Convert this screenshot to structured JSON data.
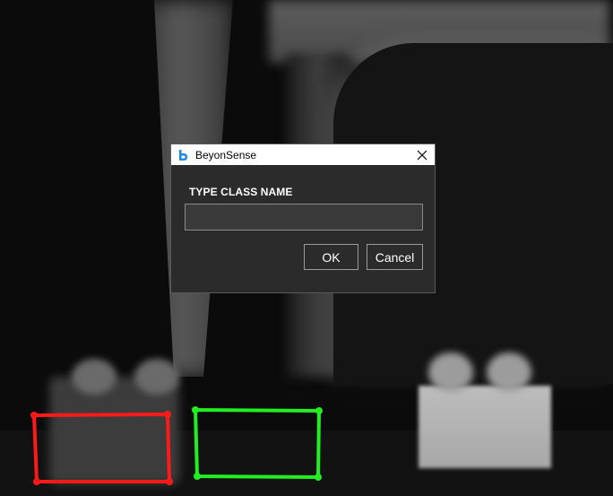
{
  "window": {
    "title": "BeyonSense",
    "app_icon": "beyonsense-logo-icon",
    "close_icon": "close-icon"
  },
  "dialog": {
    "prompt": "TYPE CLASS NAME",
    "input_value": "",
    "ok_label": "OK",
    "cancel_label": "Cancel"
  },
  "bounding_boxes": [
    {
      "color": "#ff1a1a",
      "label": "red-bbox"
    },
    {
      "color": "#22ee22",
      "label": "green-bbox"
    }
  ],
  "colors": {
    "dialog_bg": "#2b2b2b",
    "title_bar_bg": "#ffffff",
    "app_icon_color": "#1e88e5"
  }
}
